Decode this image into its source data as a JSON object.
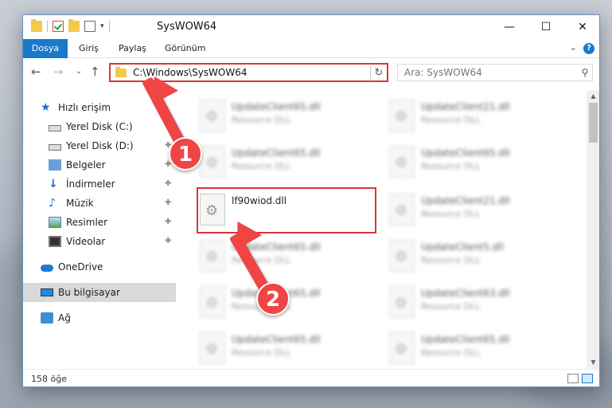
{
  "window": {
    "title": "SysWOW64",
    "controls": {
      "minimize": "—",
      "maximize": "☐",
      "close": "✕"
    }
  },
  "ribbon": {
    "tabs": [
      {
        "label": "Dosya"
      },
      {
        "label": "Giriş"
      },
      {
        "label": "Paylaş"
      },
      {
        "label": "Görünüm"
      }
    ],
    "help": "?"
  },
  "navigation": {
    "address_path": "C:\\Windows\\SysWOW64",
    "search_placeholder": "Ara: SysWOW64"
  },
  "sidebar": {
    "items": [
      {
        "label": "Hızlı erişim",
        "icon": "star-icon"
      },
      {
        "label": "Yerel Disk (C:)",
        "icon": "disk-icon",
        "pinned": true
      },
      {
        "label": "Yerel Disk (D:)",
        "icon": "disk-icon",
        "pinned": true
      },
      {
        "label": "Belgeler",
        "icon": "documents-icon",
        "pinned": true
      },
      {
        "label": "İndirmeler",
        "icon": "download-icon",
        "pinned": true
      },
      {
        "label": "Müzik",
        "icon": "music-icon",
        "pinned": true
      },
      {
        "label": "Resimler",
        "icon": "pictures-icon",
        "pinned": true
      },
      {
        "label": "Videolar",
        "icon": "videos-icon",
        "pinned": true
      },
      {
        "label": "OneDrive",
        "icon": "cloud-icon"
      },
      {
        "label": "Bu bilgisayar",
        "icon": "computer-icon",
        "selected": true
      },
      {
        "label": "Ağ",
        "icon": "network-icon"
      }
    ]
  },
  "files": [
    {
      "name": "UpdateClient65.dll",
      "type": "Resource DLL",
      "blurred": true
    },
    {
      "name": "UpdateClient21.dll",
      "type": "Resource DLL",
      "blurred": true
    },
    {
      "name": "UpdateClient65.dll",
      "type": "Resource DLL",
      "blurred": true
    },
    {
      "name": "UpdateClient65.dll",
      "type": "Resource DLL",
      "blurred": true
    },
    {
      "name": "lf90wiod.dll",
      "type": "",
      "blurred": false,
      "highlighted": true
    },
    {
      "name": "UpdateClient21.dll",
      "type": "Resource DLL",
      "blurred": true
    },
    {
      "name": "UpdateClient65.dll",
      "type": "Resource DLL",
      "blurred": true
    },
    {
      "name": "UpdateClient5.dll",
      "type": "Resource DLL",
      "blurred": true
    },
    {
      "name": "UpdateClient65.dll",
      "type": "Resource DLL",
      "blurred": true
    },
    {
      "name": "UpdateClient63.dll",
      "type": "Resource DLL",
      "blurred": true
    },
    {
      "name": "UpdateClient65.dll",
      "type": "Resource DLL",
      "blurred": true
    },
    {
      "name": "UpdateClient65.dll",
      "type": "Resource DLL",
      "blurred": true
    }
  ],
  "status": {
    "item_count": "158 öğe"
  },
  "annotations": {
    "step1": "1",
    "step2": "2",
    "accent": "#ef4545"
  }
}
